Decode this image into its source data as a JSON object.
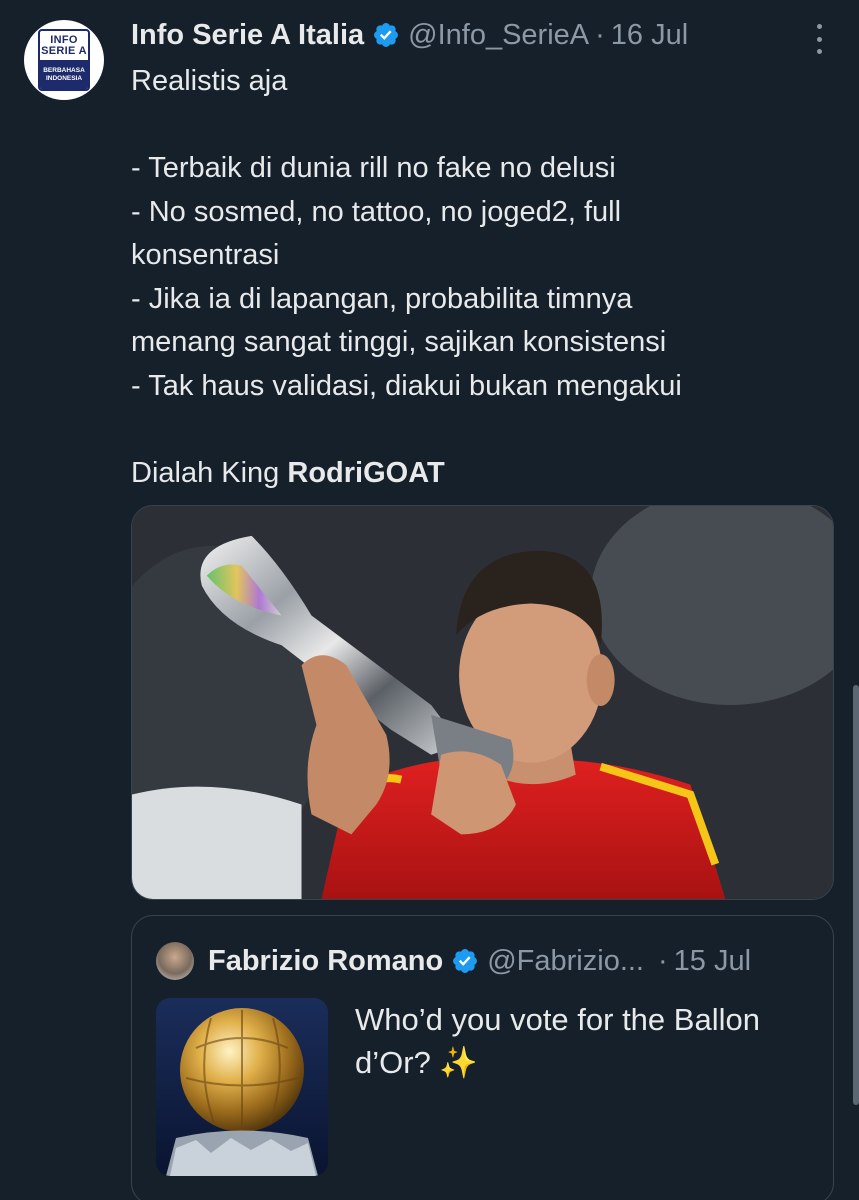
{
  "tweet": {
    "avatar": {
      "line1": "INFO",
      "line2": "SERIE A",
      "line3": "BERBAHASA",
      "line4": "INDONESIA"
    },
    "display_name": "Info Serie A Italia",
    "handle": "@Info_SerieA",
    "separator": "·",
    "date": "16 Jul",
    "more_icon": "more-vertical-icon",
    "verified_icon": "verified-badge-icon",
    "verified_color": "#1d9bf0",
    "lines": {
      "l1": "Realistis aja",
      "l2": "",
      "l3": "- Terbaik di dunia rill no fake no delusi",
      "l4": "- No sosmed, no tattoo, no joged2, full",
      "l5": "konsentrasi",
      "l6": "- Jika ia di lapangan, probabilita timnya",
      "l7": "menang sangat tinggi, sajikan konsistensi",
      "l8": "- Tak haus validasi, diakui bukan mengakui",
      "l9": "",
      "l10_prefix": "Dialah King ",
      "l10_bold": "RodriGOAT"
    },
    "media": "photo-player-kissing-trophy"
  },
  "quote": {
    "display_name": "Fabrizio Romano",
    "handle": "@Fabrizio...",
    "separator": "·",
    "date": "15 Jul",
    "text_line1": "Who’d you vote for the Ballon",
    "text_line2": "d’Or? ✨",
    "thumbnail": "ballon-dor-trophy-image"
  },
  "colors": {
    "background": "#15202b",
    "text": "#e7e9ea",
    "secondary": "#8b98a5",
    "border": "#38444d"
  }
}
